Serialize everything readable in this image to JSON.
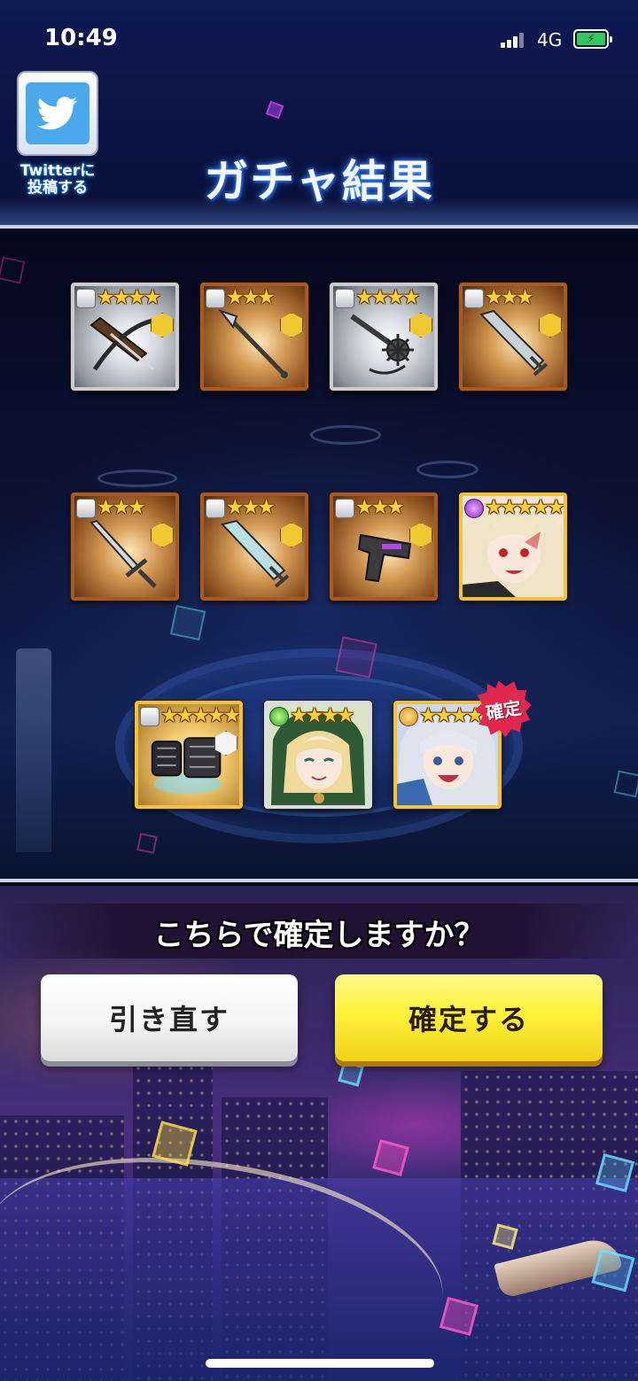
{
  "status_bar": {
    "time": "10:49",
    "network": "4G",
    "battery_level": 1.0,
    "battery_glyph": "⚡"
  },
  "header": {
    "twitter_button": {
      "icon": "twitter-bird-icon",
      "caption_line1": "Twitterに",
      "caption_line2": "投稿する"
    },
    "title": "ガチャ結果"
  },
  "results": {
    "rows": [
      [
        {
          "kind": "weapon",
          "weapon": "crossbow",
          "stars": 4,
          "frame": "silver"
        },
        {
          "kind": "weapon",
          "weapon": "spear",
          "stars": 3,
          "frame": "gold"
        },
        {
          "kind": "weapon",
          "weapon": "mace",
          "stars": 4,
          "frame": "silver"
        },
        {
          "kind": "weapon",
          "weapon": "greatsword",
          "stars": 3,
          "frame": "gold"
        }
      ],
      [
        {
          "kind": "weapon",
          "weapon": "sword",
          "stars": 3,
          "frame": "gold"
        },
        {
          "kind": "weapon",
          "weapon": "greatsword",
          "stars": 3,
          "frame": "gold"
        },
        {
          "kind": "weapon",
          "weapon": "gun",
          "stars": 3,
          "frame": "gold"
        },
        {
          "kind": "character",
          "stars": 5,
          "attribute": "purple",
          "frame": "gold-character"
        }
      ],
      [
        {
          "kind": "weapon",
          "weapon": "gauntlet",
          "stars": 5,
          "frame": "gold-character"
        },
        {
          "kind": "character",
          "stars": 4,
          "attribute": "green",
          "frame": "silver-character"
        },
        {
          "kind": "character",
          "stars": 4,
          "attribute": "orange",
          "frame": "gold-character",
          "badge": "確定"
        }
      ]
    ],
    "star_glyph": "★",
    "confirmed_badge": "確定"
  },
  "confirm": {
    "question": "こちらで確定しますか？",
    "retry_label": "引き直す",
    "confirm_label": "確定する"
  },
  "colors": {
    "accent_yellow": "#fff23a",
    "header_navy": "#0b1442",
    "badge_red": "#e0284e",
    "star_gold": "#ffd23a"
  }
}
